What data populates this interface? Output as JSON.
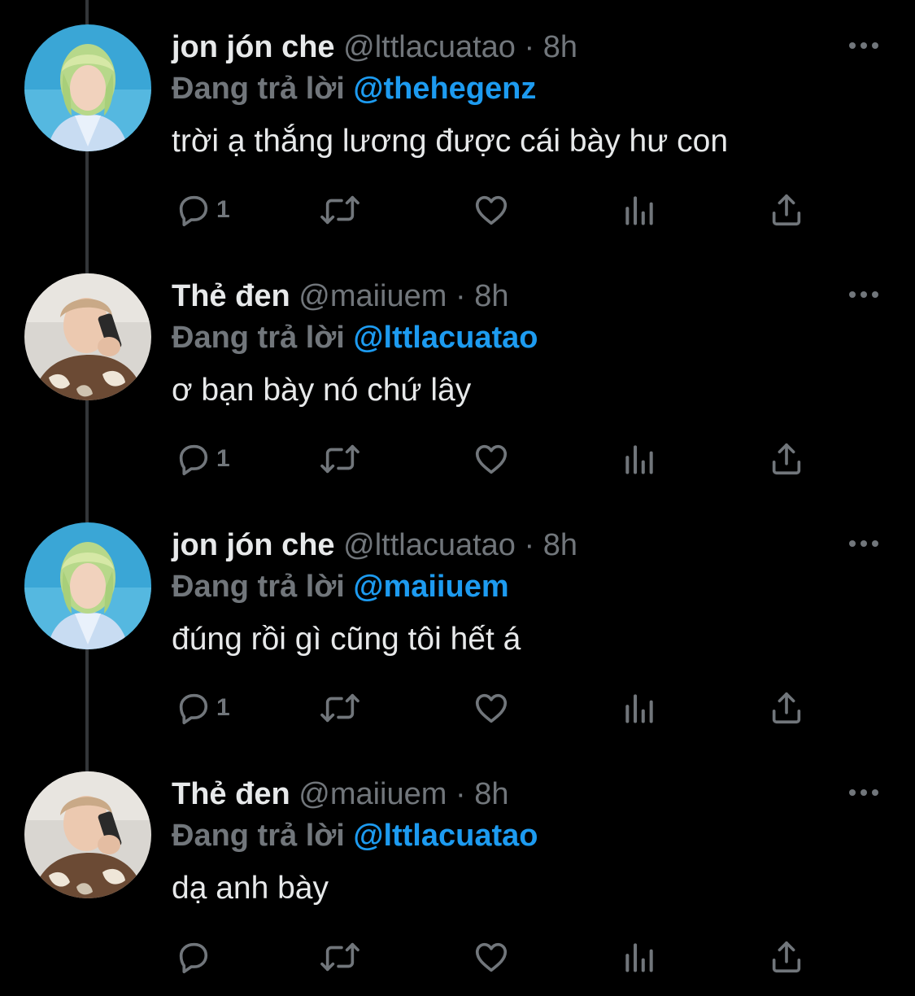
{
  "colors": {
    "background": "#000000",
    "primary_text": "#e7e9ea",
    "secondary_text": "#71767b",
    "link": "#1d9bf0",
    "thread_line": "#333639"
  },
  "icons": {
    "reply": "reply-icon",
    "retweet": "retweet-icon",
    "like": "heart-icon",
    "views": "views-icon",
    "share": "share-icon",
    "more": "more-icon"
  },
  "tweets": [
    {
      "display_name": "jon jón che",
      "handle": "@lttlacuatao",
      "separator": "·",
      "time": "8h",
      "replying_label": "Đang trả lời",
      "replying_to": "@thehegenz",
      "text": "trời ạ thắng lương được cái bày hư con",
      "reply_count": "1",
      "avatar": "avatar-green-hair"
    },
    {
      "display_name": "Thẻ đen",
      "handle": "@maiiuem",
      "separator": "·",
      "time": "8h",
      "replying_label": "Đang trả lời",
      "replying_to": "@lttlacuatao",
      "text": "ơ bạn bày nó chứ lây",
      "reply_count": "1",
      "avatar": "avatar-phone"
    },
    {
      "display_name": "jon jón che",
      "handle": "@lttlacuatao",
      "separator": "·",
      "time": "8h",
      "replying_label": "Đang trả lời",
      "replying_to": "@maiiuem",
      "text": "đúng rồi gì cũng tôi hết á",
      "reply_count": "1",
      "avatar": "avatar-green-hair"
    },
    {
      "display_name": "Thẻ đen",
      "handle": "@maiiuem",
      "separator": "·",
      "time": "8h",
      "replying_label": "Đang trả lời",
      "replying_to": "@lttlacuatao",
      "text": "dạ anh bày",
      "reply_count": "",
      "avatar": "avatar-phone"
    }
  ]
}
